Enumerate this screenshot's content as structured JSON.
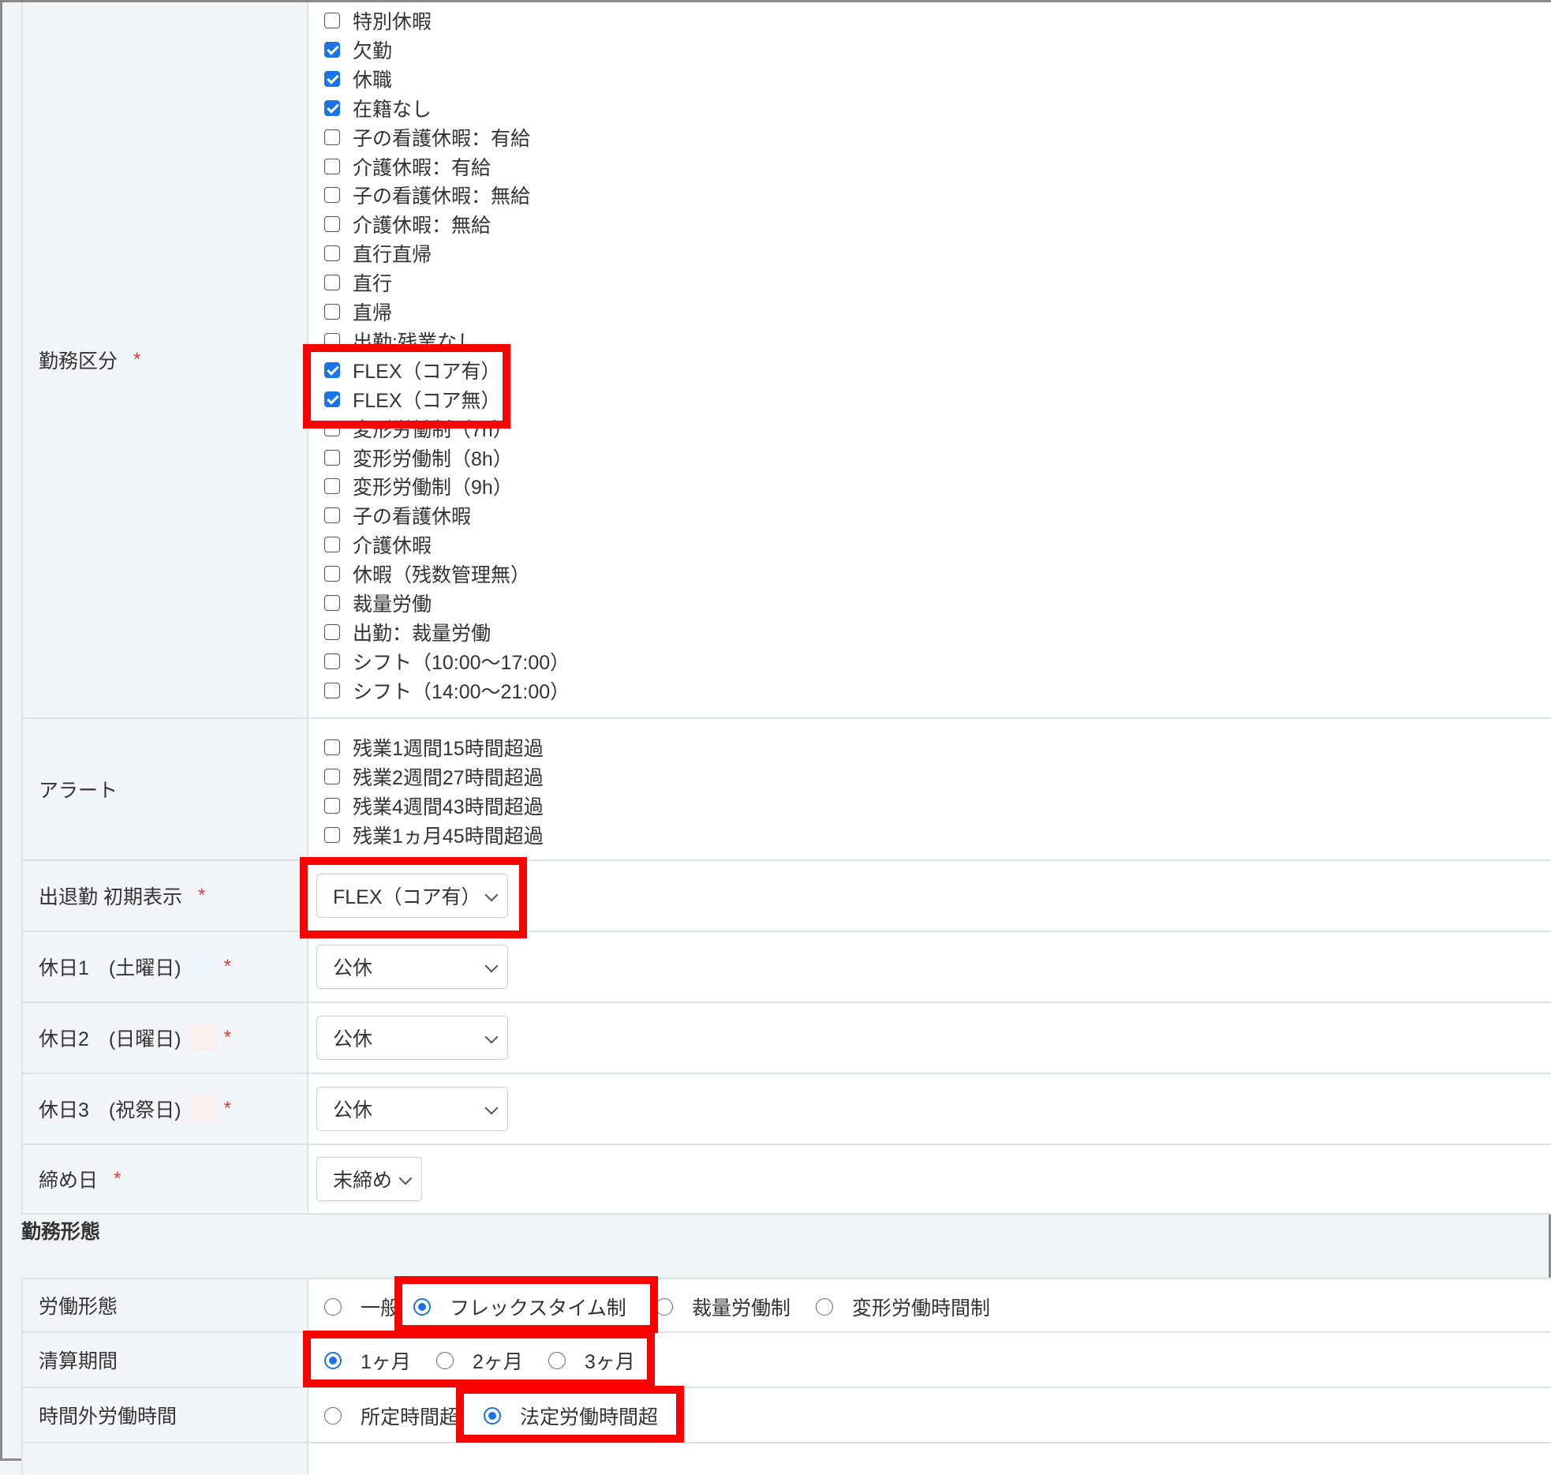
{
  "work_category": {
    "label": "勤務区分",
    "required": "*",
    "items": [
      {
        "label": "特別休暇",
        "checked": false
      },
      {
        "label": "欠勤",
        "checked": true
      },
      {
        "label": "休職",
        "checked": true
      },
      {
        "label": "在籍なし",
        "checked": true
      },
      {
        "label": "子の看護休暇：有給",
        "checked": false
      },
      {
        "label": "介護休暇：有給",
        "checked": false
      },
      {
        "label": "子の看護休暇：無給",
        "checked": false
      },
      {
        "label": "介護休暇：無給",
        "checked": false
      },
      {
        "label": "直行直帰",
        "checked": false
      },
      {
        "label": "直行",
        "checked": false
      },
      {
        "label": "直帰",
        "checked": false
      },
      {
        "label": "出勤:残業なし",
        "checked": false
      },
      {
        "label": "FLEX（コア有）",
        "checked": true
      },
      {
        "label": "FLEX（コア無）",
        "checked": true
      },
      {
        "label": "変形労働制（7h）",
        "checked": false
      },
      {
        "label": "変形労働制（8h）",
        "checked": false
      },
      {
        "label": "変形労働制（9h）",
        "checked": false
      },
      {
        "label": "子の看護休暇",
        "checked": false
      },
      {
        "label": "介護休暇",
        "checked": false
      },
      {
        "label": "休暇（残数管理無）",
        "checked": false
      },
      {
        "label": "裁量労働",
        "checked": false
      },
      {
        "label": "出勤：裁量労働",
        "checked": false
      },
      {
        "label": "シフト（10:00〜17:00）",
        "checked": false
      },
      {
        "label": "シフト（14:00〜21:00）",
        "checked": false
      }
    ]
  },
  "alert": {
    "label": "アラート",
    "items": [
      {
        "label": "残業1週間15時間超過",
        "checked": false
      },
      {
        "label": "残業2週間27時間超過",
        "checked": false
      },
      {
        "label": "残業4週間43時間超過",
        "checked": false
      },
      {
        "label": "残業1ヵ月45時間超過",
        "checked": false
      }
    ]
  },
  "default_attendance": {
    "label": "出退勤 初期表示",
    "required": "*",
    "value": "FLEX（コア有）"
  },
  "holiday1": {
    "label": "休日1　(土曜日)",
    "required": "*",
    "value": "公休",
    "swatch": "#eef4fb"
  },
  "holiday2": {
    "label": "休日2　(日曜日)",
    "required": "*",
    "value": "公休",
    "swatch": "#fcefef"
  },
  "holiday3": {
    "label": "休日3　(祝祭日)",
    "required": "*",
    "value": "公休",
    "swatch": "#fcefef"
  },
  "closing_day": {
    "label": "締め日",
    "required": "*",
    "value": "末締め"
  },
  "work_style_section": {
    "title": "勤務形態"
  },
  "labor_type": {
    "label": "労働形態",
    "options": [
      {
        "label": "一般",
        "checked": false
      },
      {
        "label": "フレックスタイム制",
        "checked": true
      },
      {
        "label": "裁量労働制",
        "checked": false
      },
      {
        "label": "変形労働時間制",
        "checked": false
      }
    ]
  },
  "settlement_period": {
    "label": "清算期間",
    "options": [
      {
        "label": "1ヶ月",
        "checked": true
      },
      {
        "label": "2ヶ月",
        "checked": false
      },
      {
        "label": "3ヶ月",
        "checked": false
      }
    ]
  },
  "overtime_hours": {
    "label": "時間外労働時間",
    "options": [
      {
        "label": "所定時間超",
        "checked": false
      },
      {
        "label": "法定労働時間超",
        "checked": true
      }
    ]
  },
  "colors": {
    "accent": "#1a73e8",
    "highlight": "#ff0000",
    "required": "#e23b3b"
  }
}
